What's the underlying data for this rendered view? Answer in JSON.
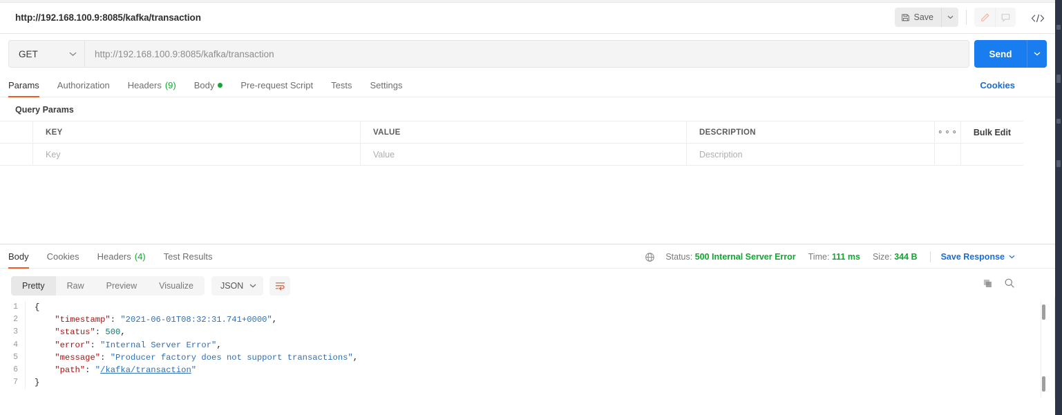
{
  "request": {
    "title": "http://192.168.100.9:8085/kafka/transaction",
    "method": "GET",
    "url": "http://192.168.100.9:8085/kafka/transaction",
    "send_label": "Send"
  },
  "header_actions": {
    "save_label": "Save",
    "save_icon": "floppy-disk-icon",
    "save_caret_icon": "chevron-down-icon",
    "edit_icon": "pencil-icon",
    "comment_icon": "comment-icon",
    "code_icon": "code-brackets-icon"
  },
  "request_tabs": [
    {
      "label": "Params",
      "active": true
    },
    {
      "label": "Authorization",
      "active": false
    },
    {
      "label": "Headers",
      "count": "(9)",
      "active": false
    },
    {
      "label": "Body",
      "dot": true,
      "active": false
    },
    {
      "label": "Pre-request Script",
      "active": false
    },
    {
      "label": "Tests",
      "active": false
    },
    {
      "label": "Settings",
      "active": false
    }
  ],
  "cookies_link": "Cookies",
  "query_params": {
    "section_title": "Query Params",
    "columns": [
      "KEY",
      "VALUE",
      "DESCRIPTION"
    ],
    "more_icon": "ellipsis-icon",
    "bulk_edit_label": "Bulk Edit",
    "placeholder_row": {
      "key": "Key",
      "value": "Value",
      "description": "Description"
    }
  },
  "response_tabs": [
    {
      "label": "Body",
      "active": true
    },
    {
      "label": "Cookies",
      "active": false
    },
    {
      "label": "Headers",
      "count": "(4)",
      "active": false
    },
    {
      "label": "Test Results",
      "active": false
    }
  ],
  "response_meta": {
    "globe_icon": "globe-icon",
    "status_label": "Status:",
    "status_value": "500 Internal Server Error",
    "time_label": "Time:",
    "time_value": "111 ms",
    "size_label": "Size:",
    "size_value": "344 B",
    "save_response_label": "Save Response",
    "save_response_caret": "chevron-down-icon"
  },
  "view_toolbar": {
    "modes": [
      {
        "label": "Pretty",
        "active": true
      },
      {
        "label": "Raw",
        "active": false
      },
      {
        "label": "Preview",
        "active": false
      },
      {
        "label": "Visualize",
        "active": false
      }
    ],
    "format": "JSON",
    "format_caret": "chevron-down-icon",
    "wrap_icon": "word-wrap-icon",
    "copy_icon": "copy-icon",
    "search_icon": "search-icon"
  },
  "response_body": {
    "line_numbers": [
      "1",
      "2",
      "3",
      "4",
      "5",
      "6",
      "7"
    ],
    "lines": [
      [
        {
          "t": "punc",
          "s": "{"
        }
      ],
      [
        {
          "t": "punc",
          "s": "    "
        },
        {
          "t": "key",
          "s": "\"timestamp\""
        },
        {
          "t": "punc",
          "s": ": "
        },
        {
          "t": "str",
          "s": "\"2021-06-01T08:32:31.741+0000\""
        },
        {
          "t": "punc",
          "s": ","
        }
      ],
      [
        {
          "t": "punc",
          "s": "    "
        },
        {
          "t": "key",
          "s": "\"status\""
        },
        {
          "t": "punc",
          "s": ": "
        },
        {
          "t": "num",
          "s": "500"
        },
        {
          "t": "punc",
          "s": ","
        }
      ],
      [
        {
          "t": "punc",
          "s": "    "
        },
        {
          "t": "key",
          "s": "\"error\""
        },
        {
          "t": "punc",
          "s": ": "
        },
        {
          "t": "str",
          "s": "\"Internal Server Error\""
        },
        {
          "t": "punc",
          "s": ","
        }
      ],
      [
        {
          "t": "punc",
          "s": "    "
        },
        {
          "t": "key",
          "s": "\"message\""
        },
        {
          "t": "punc",
          "s": ": "
        },
        {
          "t": "str",
          "s": "\"Producer factory does not support transactions\""
        },
        {
          "t": "punc",
          "s": ","
        }
      ],
      [
        {
          "t": "punc",
          "s": "    "
        },
        {
          "t": "key",
          "s": "\"path\""
        },
        {
          "t": "punc",
          "s": ": "
        },
        {
          "t": "str",
          "s": "\""
        },
        {
          "t": "link",
          "s": "/kafka/transaction"
        },
        {
          "t": "str",
          "s": "\""
        }
      ],
      [
        {
          "t": "punc",
          "s": "}"
        }
      ]
    ]
  },
  "colors": {
    "accent_orange": "#ef5b25",
    "send_blue": "#1a7def",
    "link_blue": "#1a6cd4",
    "status_green": "#0fa82e",
    "rail_dark": "#2b3544"
  }
}
